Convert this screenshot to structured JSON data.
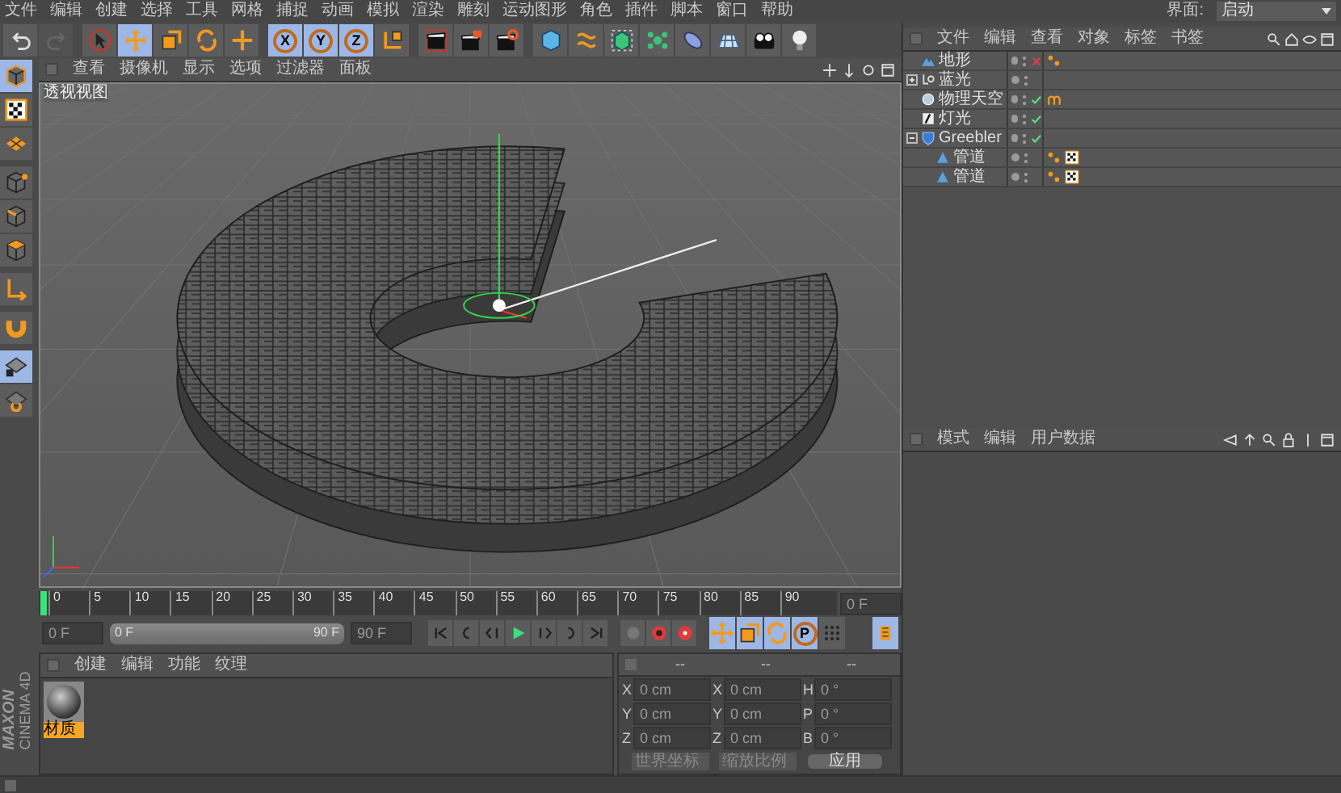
{
  "menu": [
    "文件",
    "编辑",
    "创建",
    "选择",
    "工具",
    "网格",
    "捕捉",
    "动画",
    "模拟",
    "渲染",
    "雕刻",
    "运动图形",
    "角色",
    "插件",
    "脚本",
    "窗口",
    "帮助"
  ],
  "layout_switch": {
    "label": "界面:",
    "value": "启动"
  },
  "history": [
    {
      "kind": "undo",
      "disabled": false
    },
    {
      "kind": "redo",
      "disabled": true
    }
  ],
  "toolbar_groups": [
    {
      "tools": [
        {
          "kind": "select",
          "selected": false
        },
        {
          "kind": "move",
          "selected": true
        },
        {
          "kind": "scale",
          "selected": false
        },
        {
          "kind": "rotate",
          "selected": false
        },
        {
          "kind": "add",
          "selected": false
        }
      ]
    },
    {
      "tools": [
        {
          "kind": "axis",
          "label": "X",
          "selected": true
        },
        {
          "kind": "axis",
          "label": "Y",
          "selected": true
        },
        {
          "kind": "axis",
          "label": "Z",
          "selected": true
        },
        {
          "kind": "coord",
          "selected": false
        }
      ]
    },
    {
      "tools": [
        {
          "kind": "render-view",
          "selected": false
        },
        {
          "kind": "render",
          "selected": false
        },
        {
          "kind": "render-settings",
          "selected": false
        }
      ]
    },
    {
      "tools": [
        {
          "kind": "cube",
          "selected": false
        },
        {
          "kind": "spline",
          "selected": false
        },
        {
          "kind": "nurbs",
          "selected": false
        },
        {
          "kind": "array",
          "selected": false
        },
        {
          "kind": "deformer",
          "selected": false
        },
        {
          "kind": "floor",
          "selected": false
        },
        {
          "kind": "camera",
          "selected": false
        },
        {
          "kind": "light",
          "selected": false
        }
      ]
    }
  ],
  "mode_tool_groups": [
    {
      "tools": [
        {
          "kind": "model",
          "selected": true
        },
        {
          "kind": "texture",
          "selected": false
        },
        {
          "kind": "workplane",
          "selected": false
        }
      ]
    },
    {
      "tools": [
        {
          "kind": "points",
          "selected": false
        },
        {
          "kind": "edges",
          "selected": false
        },
        {
          "kind": "polygons",
          "selected": false
        }
      ]
    },
    {
      "tools": [
        {
          "kind": "axis",
          "selected": false
        }
      ]
    },
    {
      "tools": [
        {
          "kind": "magnet",
          "selected": false
        }
      ]
    },
    {
      "tools": [
        {
          "kind": "grid-lock",
          "selected": true
        },
        {
          "kind": "snap",
          "selected": false
        }
      ]
    }
  ],
  "viewport": {
    "menu": [
      "查看",
      "摄像机",
      "显示",
      "选项",
      "过滤器",
      "面板"
    ],
    "label": "透视视图"
  },
  "object_manager": {
    "menu": [
      "文件",
      "编辑",
      "查看",
      "对象",
      "标签",
      "书签"
    ],
    "objects": [
      {
        "name": "地形",
        "kind": "terrain",
        "enabled": false,
        "tags": [
          {
            "kind": "phong"
          }
        ]
      },
      {
        "name": "蓝光",
        "kind": "null",
        "expanded": false
      },
      {
        "name": "物理天空",
        "kind": "sky",
        "enabled": true,
        "tags": [
          {
            "kind": "sky"
          }
        ]
      },
      {
        "name": "灯光",
        "kind": "light",
        "enabled": true
      },
      {
        "name": "Greebler",
        "kind": "generator",
        "expanded": true,
        "enabled": true,
        "children": [
          {
            "name": "管道",
            "kind": "tube",
            "tags": [
              {
                "kind": "phong"
              },
              {
                "kind": "texture"
              }
            ]
          },
          {
            "name": "管道",
            "kind": "tube",
            "tags": [
              {
                "kind": "phong"
              },
              {
                "kind": "texture"
              }
            ]
          }
        ]
      }
    ]
  },
  "attributes": {
    "menu": [
      "模式",
      "编辑",
      "用户数据"
    ]
  },
  "timeline": {
    "ticks": [
      "0",
      "5",
      "10",
      "15",
      "20",
      "25",
      "30",
      "35",
      "40",
      "45",
      "50",
      "55",
      "60",
      "65",
      "70",
      "75",
      "80",
      "85",
      "90"
    ],
    "level": 0,
    "frame": "0 F"
  },
  "playback": {
    "start": "0 F",
    "range_start": "0 F",
    "range_end": "90 F",
    "end": "90 F",
    "level": 1,
    "key_modes": [
      {
        "kind": "position",
        "selected": true
      },
      {
        "kind": "scale",
        "selected": true
      },
      {
        "kind": "rotation",
        "selected": true
      },
      {
        "kind": "parameter",
        "label": "P",
        "selected": true
      },
      {
        "kind": "pla",
        "selected": false
      }
    ]
  },
  "materials": {
    "menu": [
      "创建",
      "编辑",
      "功能",
      "纹理"
    ],
    "items": [
      {
        "name": "材质",
        "selected": true
      }
    ]
  },
  "coordinates": {
    "headers": [
      "--",
      "--",
      "--"
    ],
    "rows": [
      {
        "axis": "X",
        "position": "0 cm",
        "size_axis": "X",
        "size": "0 cm",
        "rotation_axis": "H",
        "rotation": "0 °"
      },
      {
        "axis": "Y",
        "position": "0 cm",
        "size_axis": "Y",
        "size": "0 cm",
        "rotation_axis": "P",
        "rotation": "0 °"
      },
      {
        "axis": "Z",
        "position": "0 cm",
        "size_axis": "Z",
        "size": "0 cm",
        "rotation_axis": "B",
        "rotation": "0 °"
      }
    ],
    "coord_system": "世界坐标",
    "scale_mode": "缩放比例",
    "apply": "应用"
  },
  "logo": {
    "brand": "MAXON",
    "product": "CINEMA 4D"
  }
}
